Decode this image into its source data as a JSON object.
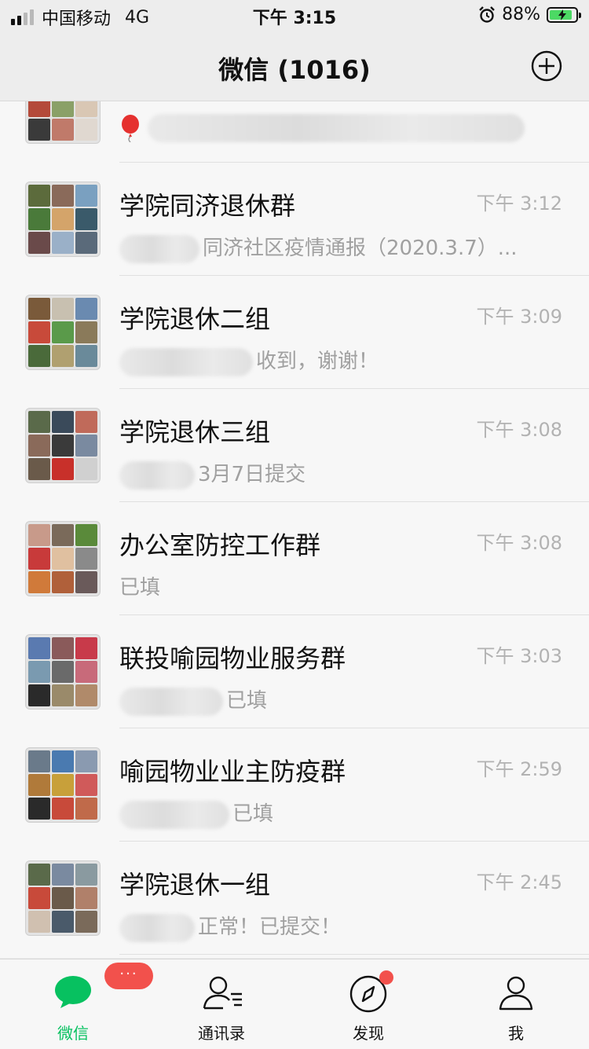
{
  "status_bar": {
    "carrier": "中国移动",
    "network": "4G",
    "time": "下午 3:15",
    "battery": "88%",
    "battery_level": 0.88
  },
  "header": {
    "title": "微信 (1016)"
  },
  "chats": [
    {
      "name": "",
      "time": "",
      "preview": "",
      "partial": true
    },
    {
      "name": "学院同济退休群",
      "time": "下午 3:12",
      "preview": "同济社区疫情通报（2020.3.7）..."
    },
    {
      "name": "学院退休二组",
      "time": "下午 3:09",
      "preview": "收到，谢谢！"
    },
    {
      "name": "学院退休三组",
      "time": "下午 3:08",
      "preview": "3月7日提交"
    },
    {
      "name": "办公室防控工作群",
      "time": "下午 3:08",
      "preview": "已填"
    },
    {
      "name": "联投喻园物业服务群",
      "time": "下午 3:03",
      "preview": "已填"
    },
    {
      "name": "喻园物业业主防疫群",
      "time": "下午 2:59",
      "preview": "已填"
    },
    {
      "name": "学院退休一组",
      "time": "下午 2:45",
      "preview": "正常！已提交！"
    }
  ],
  "tabs": [
    {
      "label": "微信",
      "badge": "···",
      "active": true
    },
    {
      "label": "通讯录"
    },
    {
      "label": "发现",
      "dot": true
    },
    {
      "label": "我"
    }
  ],
  "colors": {
    "accent": "#07c160",
    "badge": "#f2514c"
  }
}
